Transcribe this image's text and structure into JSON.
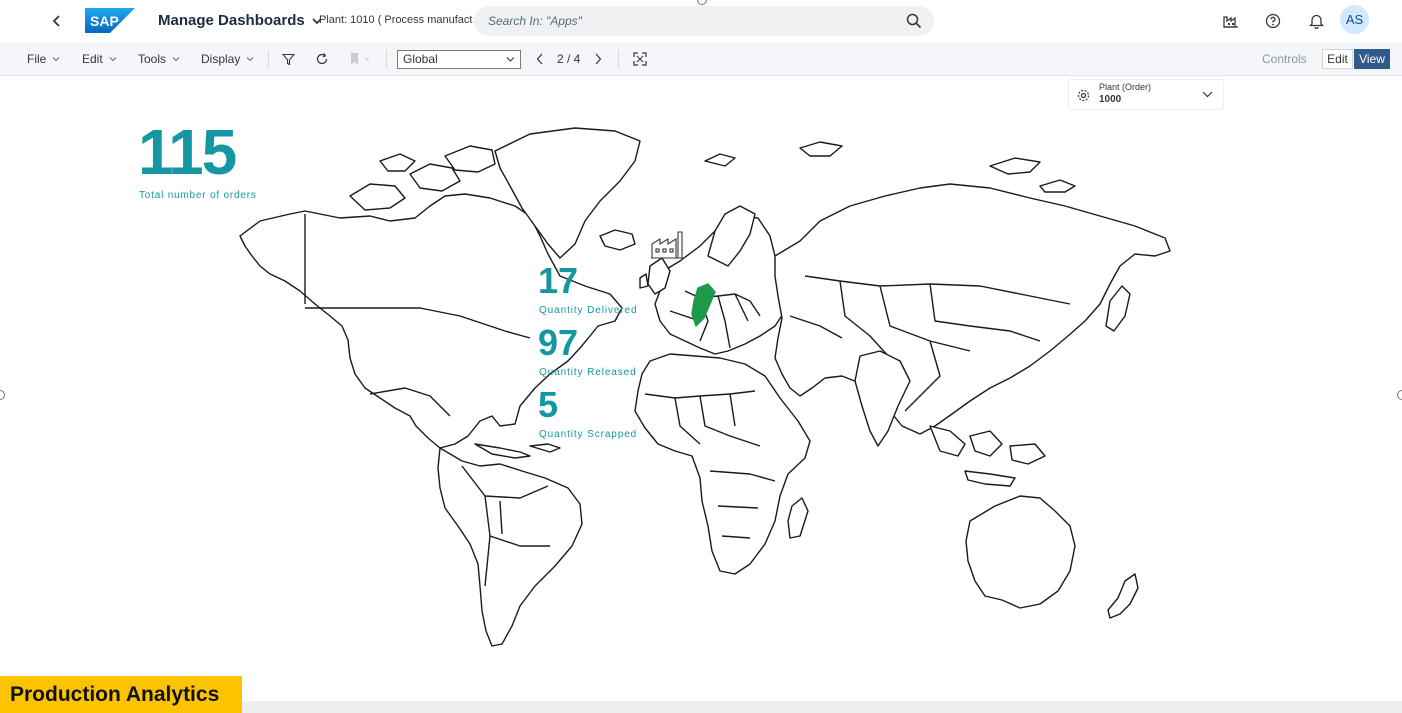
{
  "shell": {
    "app_title": "Manage Dashboards",
    "plant_context": "Plant: 1010 ( Process manufact…",
    "search_placeholder": "Search In: \"Apps\"",
    "avatar_initials": "AS",
    "logo_text": "SAP"
  },
  "toolbar": {
    "menus": [
      "File",
      "Edit",
      "Tools",
      "Display"
    ],
    "view_select": "Global",
    "page_indicator": "2 / 4",
    "controls_label": "Controls",
    "edit_label": "Edit",
    "view_label": "View"
  },
  "dashboard": {
    "plant_filter": {
      "title": "Plant (Order)",
      "value": "1000"
    },
    "total_orders": {
      "value": "115",
      "label": "Total number of orders"
    },
    "kpis": [
      {
        "value": "17",
        "label": "Quantity Delivered"
      },
      {
        "value": "97",
        "label": "Quantity Released"
      },
      {
        "value": "5",
        "label": "Quantity Scrapped"
      }
    ],
    "highlight_country_color": "#1e9a4c",
    "kpi_color": "#1497a3"
  },
  "caption": "Production Analytics"
}
